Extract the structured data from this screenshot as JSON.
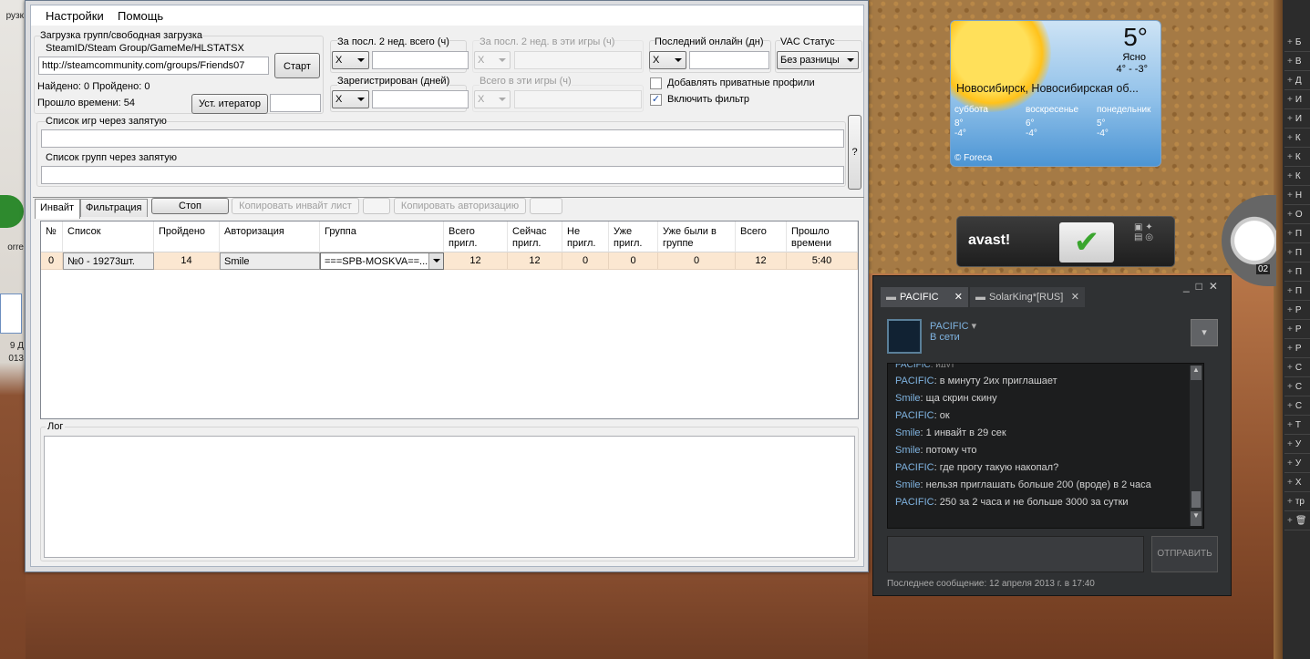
{
  "window": {
    "menu": [
      "Настройки",
      "Помощь"
    ],
    "load_group": {
      "legend": "Загрузка групп/свободная загрузка",
      "source_label": "SteamID/Steam Group/GameMe/HLSTATSX",
      "url_value": "http://steamcommunity.com/groups/Friends07",
      "start_button": "Старт",
      "found": "Найдено: 0 Пройдено: 0",
      "elapsed": "Прошло времени: 54",
      "iterator_button": "Уст. итератор"
    },
    "filters": {
      "last2w_total": "За посл. 2 нед. всего (ч)",
      "last2w_games": "За посл. 2 нед. в эти игры (ч)",
      "last_online": "Последний онлайн (дн)",
      "vac": "VAC Статус",
      "registered": "Зарегистрирован (дней)",
      "total_games": "Всего  в эти игры (ч)",
      "combo_x": "X",
      "vac_value": "Без разницы",
      "add_private": "Добавлять приватные профили",
      "enable_filter": "Включить фильтр",
      "enable_filter_checked": "✓"
    },
    "games_list_label": "Список игр через запятую",
    "groups_list_label": "Список групп через запятую",
    "help_button": "?",
    "tabs": [
      "Инвайт",
      "Фильтрация"
    ],
    "actions": {
      "stop": "Стоп",
      "copy_invite": "Копировать инвайт лист",
      "copy_auth": "Копировать авторизацию"
    },
    "grid": {
      "headers": [
        "№",
        "Список",
        "Пройдено",
        "Авторизация",
        "Группа",
        "Всего пригл.",
        "Сейчас пригл.",
        "Не пригл.",
        "Уже пригл.",
        "Уже были в группе",
        "Всего",
        "Прошло времени"
      ],
      "rows": [
        [
          "0",
          "№0 - 19273шт.",
          "14",
          "Smile",
          "===SPB-MOSKVA==...",
          "12",
          "12",
          "0",
          "0",
          "0",
          "12",
          "5:40"
        ]
      ]
    },
    "log_label": "Лог"
  },
  "weather": {
    "temp": "5°",
    "cond": "Ясно",
    "range": "4° - -3°",
    "city": "Новосибирск, Новосибирская об...",
    "days": [
      {
        "name": "суббота",
        "hi": "8°",
        "lo": "-4°"
      },
      {
        "name": "воскресенье",
        "hi": "6°",
        "lo": "-4°"
      },
      {
        "name": "понедельник",
        "hi": "5°",
        "lo": "-4°"
      }
    ],
    "credit": "© Foreca"
  },
  "avast": {
    "logo": "avast!"
  },
  "chat": {
    "tabs": [
      "PACIFIC",
      "SolarKing*[RUS]"
    ],
    "user": "PACIFIC",
    "status": "В сети",
    "messages": [
      {
        "who": "PACIFIC",
        "text": "в минуту 2их приглашает"
      },
      {
        "who": "Smile",
        "text": "ща скрин скину"
      },
      {
        "who": "PACIFIC",
        "text": "ок"
      },
      {
        "who": "Smile",
        "text": "1 инвайт в 29 сек"
      },
      {
        "who": "Smile",
        "text": "потому что"
      },
      {
        "who": "PACIFIC",
        "text": "где прогу такую накопал?"
      },
      {
        "who": "Smile",
        "text": "нельзя приглашать больше 200 (вроде) в 2 часа"
      },
      {
        "who": "PACIFIC",
        "text": "250 за 2 часа и не больше 3000 за сутки"
      }
    ],
    "send": "ОТПРАВИТЬ",
    "last": "Последнее сообщение: 12 апреля 2013 г. в 17:40"
  },
  "desktop": {
    "left_labels": [
      "рузк",
      "orre",
      "9 Д",
      "013"
    ],
    "right_items": [
      "Б",
      "В",
      "Д",
      "И",
      "И",
      "К",
      "К",
      "К",
      "Н",
      "О",
      "П",
      "П",
      "П",
      "П",
      "Р",
      "Р",
      "Р",
      "С",
      "С",
      "С",
      "Т",
      "У",
      "У",
      "Х",
      "тр",
      "🗑"
    ],
    "clock": "02"
  }
}
